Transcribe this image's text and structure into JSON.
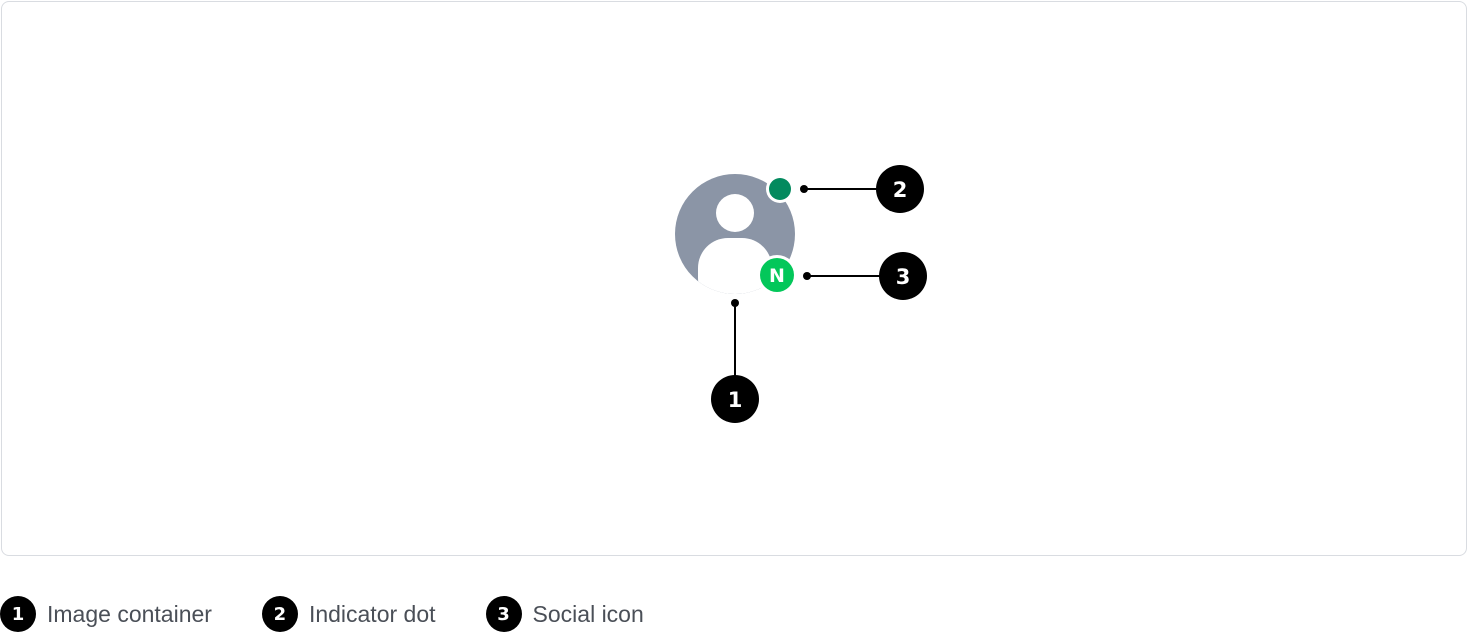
{
  "diagram": {
    "social_icon_letter": "N",
    "colors": {
      "avatar_bg": "#8b95a6",
      "avatar_figure": "#ffffff",
      "indicator_dot": "#038a5e",
      "social_icon": "#03c75a",
      "callout": "#000000"
    },
    "callouts": [
      {
        "number": "1",
        "target": "image-container"
      },
      {
        "number": "2",
        "target": "indicator-dot"
      },
      {
        "number": "3",
        "target": "social-icon"
      }
    ]
  },
  "legend": {
    "items": [
      {
        "number": "1",
        "label": "Image container"
      },
      {
        "number": "2",
        "label": "Indicator dot"
      },
      {
        "number": "3",
        "label": "Social icon"
      }
    ]
  }
}
